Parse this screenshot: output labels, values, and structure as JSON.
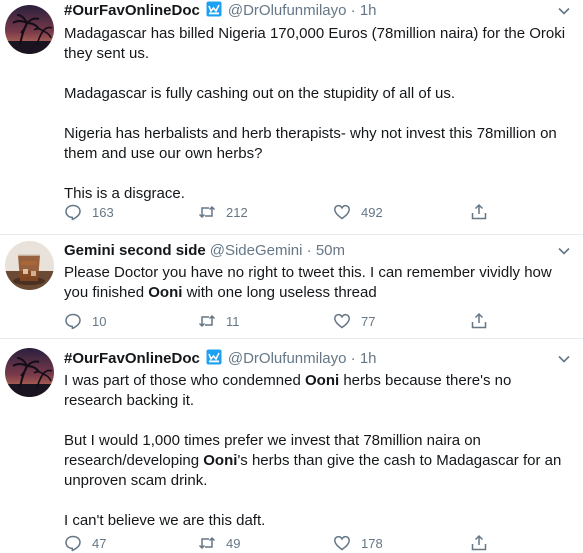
{
  "tweets": [
    {
      "name": "#OurFavOnlineDoc",
      "handle": "@DrOlufunmilayo",
      "separator": "·",
      "time": "1h",
      "paragraphs": [
        [
          {
            "t": "Madagascar has billed Nigeria 170,000 Euros (78million naira) for the Oroki they sent us."
          }
        ],
        [
          {
            "t": "Madagascar is fully cashing out on the stupidity of all of us."
          }
        ],
        [
          {
            "t": "Nigeria has herbalists and herb therapists- why not invest this 78million on them and use our own herbs?"
          }
        ],
        [
          {
            "t": "This is a disgrace."
          }
        ]
      ],
      "replies": "163",
      "retweets": "212",
      "likes": "492",
      "avatar": "palm-sunset"
    },
    {
      "name": "Gemini second side",
      "handle": "@SideGemini",
      "separator": "·",
      "time": "50m",
      "paragraphs": [
        [
          {
            "t": "Please Doctor you have no right to tweet this. I can remember vividly how you finished "
          },
          {
            "t": "Ooni",
            "b": true
          },
          {
            "t": " with one long useless thread"
          }
        ]
      ],
      "replies": "10",
      "retweets": "11",
      "likes": "77",
      "avatar": "drink-glass"
    },
    {
      "name": "#OurFavOnlineDoc",
      "handle": "@DrOlufunmilayo",
      "separator": "·",
      "time": "1h",
      "paragraphs": [
        [
          {
            "t": "I was part of those who condemned "
          },
          {
            "t": "Ooni",
            "b": true
          },
          {
            "t": " herbs because there's no research backing it."
          }
        ],
        [
          {
            "t": "But I would 1,000 times prefer we invest that 78million naira on research/developing "
          },
          {
            "t": "Ooni",
            "b": true
          },
          {
            "t": "'s herbs than give the cash to Madagascar for an unproven scam drink."
          }
        ],
        [
          {
            "t": "I can't believe we are this daft."
          }
        ]
      ],
      "replies": "47",
      "retweets": "49",
      "likes": "178",
      "avatar": "palm-sunset"
    }
  ],
  "colors": {
    "text": "#14171a",
    "muted": "#657786",
    "verified": "#1da1f2",
    "divider": "#e6ecf0"
  },
  "icons": {
    "reply": "reply-icon",
    "retweet": "retweet-icon",
    "like": "like-icon",
    "share": "share-icon",
    "verified": "verified-icon",
    "menu": "chevron-down-icon"
  }
}
